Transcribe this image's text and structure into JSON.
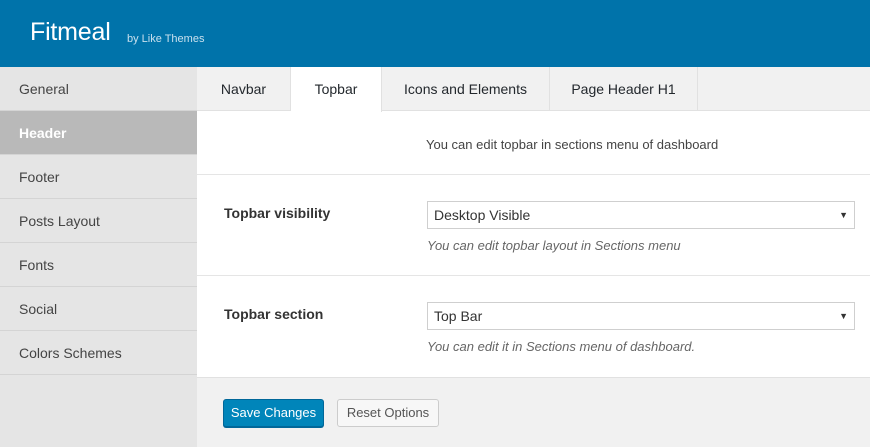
{
  "header": {
    "title": "Fitmeal",
    "byline": "by Like Themes"
  },
  "sidebar": {
    "items": [
      {
        "label": "General"
      },
      {
        "label": "Header"
      },
      {
        "label": "Footer"
      },
      {
        "label": "Posts Layout"
      },
      {
        "label": "Fonts"
      },
      {
        "label": "Social"
      },
      {
        "label": "Colors Schemes"
      }
    ],
    "active_index": 1
  },
  "tabs": [
    {
      "label": "Navbar"
    },
    {
      "label": "Topbar"
    },
    {
      "label": "Icons and Elements"
    },
    {
      "label": "Page Header H1"
    }
  ],
  "active_tab_index": 1,
  "notice": "You can edit topbar in sections menu of dashboard",
  "fields": {
    "visibility": {
      "label": "Topbar visibility",
      "value": "Desktop Visible",
      "hint": "You can edit topbar layout in Sections menu",
      "caret": "▼"
    },
    "section": {
      "label": "Topbar section",
      "value": "Top Bar",
      "hint": "You can edit it in Sections menu of dashboard.",
      "caret": "▼"
    }
  },
  "buttons": {
    "save": "Save Changes",
    "reset": "Reset Options"
  },
  "colors": {
    "header_bg": "#0073aa",
    "primary_button": "#0085ba",
    "active_sidebar": "#b9b9b9"
  }
}
